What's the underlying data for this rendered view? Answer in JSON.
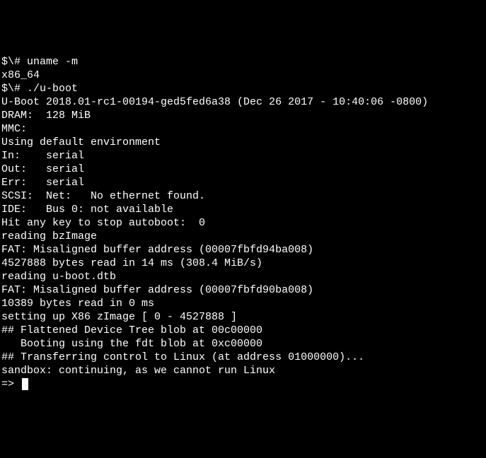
{
  "terminal": {
    "lines": [
      "$\\# uname -m",
      "x86_64",
      "$\\# ./u-boot",
      "",
      "",
      "U-Boot 2018.01-rc1-00194-ged5fed6a38 (Dec 26 2017 - 10:40:06 -0800)",
      "",
      "DRAM:  128 MiB",
      "MMC:",
      "Using default environment",
      "",
      "In:    serial",
      "Out:   serial",
      "Err:   serial",
      "SCSI:  Net:   No ethernet found.",
      "IDE:   Bus 0: not available",
      "Hit any key to stop autoboot:  0",
      "reading bzImage",
      "FAT: Misaligned buffer address (00007fbfd94ba008)",
      "4527888 bytes read in 14 ms (308.4 MiB/s)",
      "reading u-boot.dtb",
      "FAT: Misaligned buffer address (00007fbfd90ba008)",
      "10389 bytes read in 0 ms",
      "setting up X86 zImage [ 0 - 4527888 ]",
      "## Flattened Device Tree blob at 00c00000",
      "   Booting using the fdt blob at 0xc00000",
      "## Transferring control to Linux (at address 01000000)...",
      "sandbox: continuing, as we cannot run Linux"
    ],
    "prompt": "=> "
  }
}
